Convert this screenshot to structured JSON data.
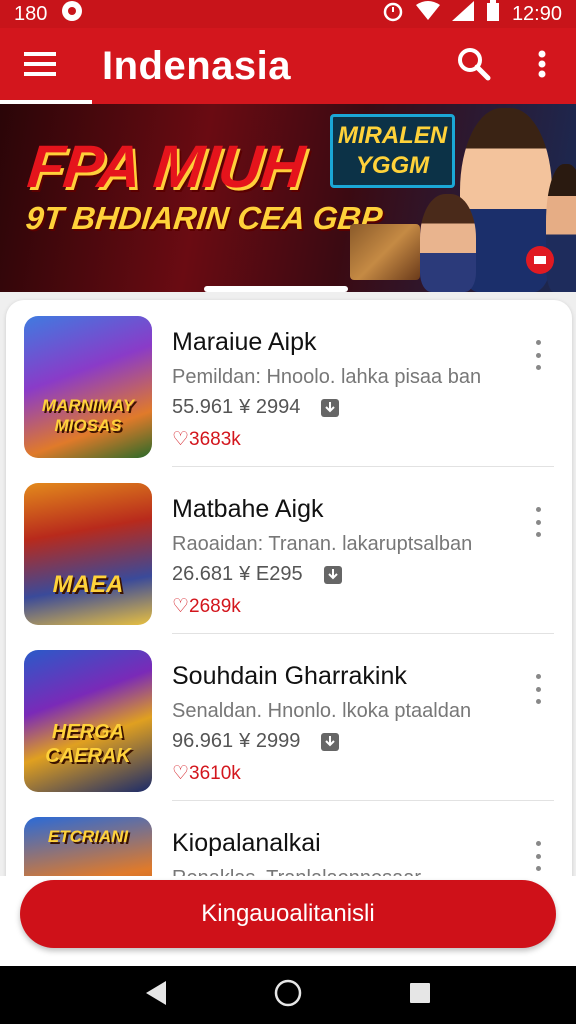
{
  "status_bar": {
    "left_text": "180",
    "time": "12:90",
    "icons": [
      "notification-icon",
      "alarm-icon",
      "wifi-icon",
      "signal-icon",
      "battery-icon"
    ]
  },
  "app_bar": {
    "title": "Indenasia",
    "icons": [
      "menu-icon",
      "search-icon",
      "more-vert-icon"
    ],
    "accent": "#d3161d"
  },
  "banner": {
    "headline": "FPA MIUH",
    "subline": "9T BHDIARIN CEA GBP",
    "tag": "MIRALEN YGGM"
  },
  "apps": [
    {
      "name": "Maraiue Aipk",
      "description": "Pemildan: Hnoolo. lahka pisaa ban",
      "size": "55.961",
      "rating": "¥ 2994",
      "price": "♡3683k",
      "icon_text": "MARNIMAY MIOSAS"
    },
    {
      "name": "Matbahe Aigk",
      "description": "Raoaidan: Tranan. lakaruptsalban",
      "size": "26.681",
      "rating": "¥ E295",
      "price": "♡2689k",
      "icon_text": "MAEA"
    },
    {
      "name": "Souhdain Gharrakink",
      "description": "Senaldan. Hnonlo. lkoka ptaaldan",
      "size": "96.961",
      "rating": "¥ 2999",
      "price": "♡3610k",
      "icon_text": "HERGA CAERAK"
    },
    {
      "name": "Kiopalanalkai",
      "description": "Renaklas. Tranlalaonnosaar",
      "size": "",
      "rating": "",
      "price": "",
      "icon_text": "ETCRIANI"
    }
  ],
  "cta": {
    "label": "Kingauoalitanisli"
  },
  "nav_bar": {
    "icons": [
      "back-icon",
      "home-icon",
      "recents-icon"
    ]
  }
}
